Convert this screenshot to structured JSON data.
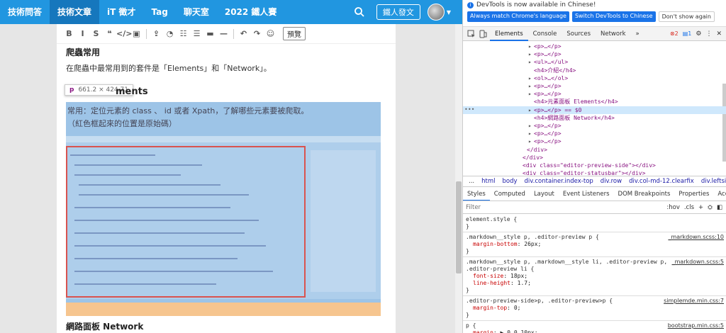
{
  "nav": {
    "items": [
      "技術問答",
      "技術文章",
      "iT 徵才",
      "Tag",
      "聊天室",
      "2022 鐵人賽"
    ],
    "active_index": 1,
    "post_button": "鐵人發文"
  },
  "editor": {
    "toolbar_icons": [
      "bold-icon",
      "italic-icon",
      "heading-icon",
      "quote-icon",
      "code-icon",
      "image-icon",
      "upload-icon",
      "chart-icon",
      "ordered-list-icon",
      "unordered-list-icon",
      "table-icon",
      "horizontal-rule-icon",
      "undo-icon",
      "redo-icon",
      "emoji-icon"
    ],
    "toolbar_glyphs": [
      "B",
      "I",
      "S",
      "❝",
      "</>",
      "▣",
      "⇪",
      "◔",
      "☷",
      "☰",
      "▬",
      "—",
      "↶",
      "↷",
      "☺"
    ],
    "preview_button": "預覽",
    "heading_crawler": "爬蟲常用",
    "para_crawler": "在爬蟲中最常用到的套件是「Elements」和「Network」。",
    "heading_elements_partial": "ments",
    "tooltip_tag": "p",
    "tooltip_dims": "661.2 × 424.71",
    "hl_line1": "常用：定位元素的 class 、 id 或者 Xpath，了解哪些元素要被爬取。",
    "hl_line2": "（紅色框起來的位置是原始碼）",
    "heading_network": "網路面板 Network"
  },
  "devtools": {
    "info_text": "DevTools is now available in Chinese!",
    "info_buttons": [
      "Always match Chrome's language",
      "Switch DevTools to Chinese",
      "Don't show again"
    ],
    "tabs": [
      "Elements",
      "Console",
      "Sources",
      "Network",
      "»"
    ],
    "errors": "2",
    "messages": "1",
    "dom_lines": [
      {
        "text": "<p>…</p>"
      },
      {
        "text": "<p>…</p>"
      },
      {
        "text": "<ul>…</ul>"
      },
      {
        "text": "<h4>介紹</h4>"
      },
      {
        "text": "<ol>…</ol>"
      },
      {
        "text": "<p>…</p>"
      },
      {
        "text": "<p>…</p>"
      },
      {
        "text": "<h4>元素面板 Elements</h4>"
      },
      {
        "text": "<p>…</p> == $0"
      },
      {
        "text": "<h4>網路面板 Network</h4>"
      },
      {
        "text": "<p>…</p>"
      },
      {
        "text": "<p>…</p>"
      },
      {
        "text": "<p>…</p>"
      },
      {
        "text": "</div>"
      },
      {
        "text": "</div>"
      },
      {
        "text": "<div class=\"editor-preview-side\"></div>"
      },
      {
        "text": "<div class=\"editor-statusbar\"></div>"
      }
    ],
    "crumbs": [
      "...",
      "html",
      "body",
      "div.container.index-top",
      "div.row",
      "div.col-md-12.clearfix",
      "div.leftside.leftside-"
    ],
    "subtabs": [
      "Styles",
      "Computed",
      "Layout",
      "Event Listeners",
      "DOM Breakpoints",
      "Properties",
      "Accessibility"
    ],
    "filter_placeholder": "Filter",
    "filter_tools": [
      ":hov",
      ".cls",
      "+"
    ],
    "rules": [
      {
        "selector": "element.style {",
        "source": "",
        "props": [],
        "close": "}"
      },
      {
        "selector": ".markdown__style p, .editor-preview p {",
        "source": "_markdown.scss:10",
        "props": [
          {
            "name": "margin-bottom",
            "value": "26px;"
          }
        ],
        "close": "}"
      },
      {
        "selector": ".markdown__style p, .markdown__style li, .editor-preview p,",
        "selector2": ".editor-preview li {",
        "source": "_markdown.scss:5",
        "props": [
          {
            "name": "font-size",
            "value": "18px;"
          },
          {
            "name": "line-height",
            "value": "1.7;"
          }
        ],
        "close": "}"
      },
      {
        "selector": ".editor-preview-side>p, .editor-preview>p {",
        "source": "simplemde.min.css:7",
        "props": [
          {
            "name": "margin-top",
            "value": "0;"
          }
        ],
        "close": "}"
      },
      {
        "selector": "p {",
        "source": "bootstrap.min.css:5",
        "props": [
          {
            "name": "margin",
            "value": "▶ 0 0 10px;"
          }
        ],
        "close": ""
      }
    ]
  }
}
